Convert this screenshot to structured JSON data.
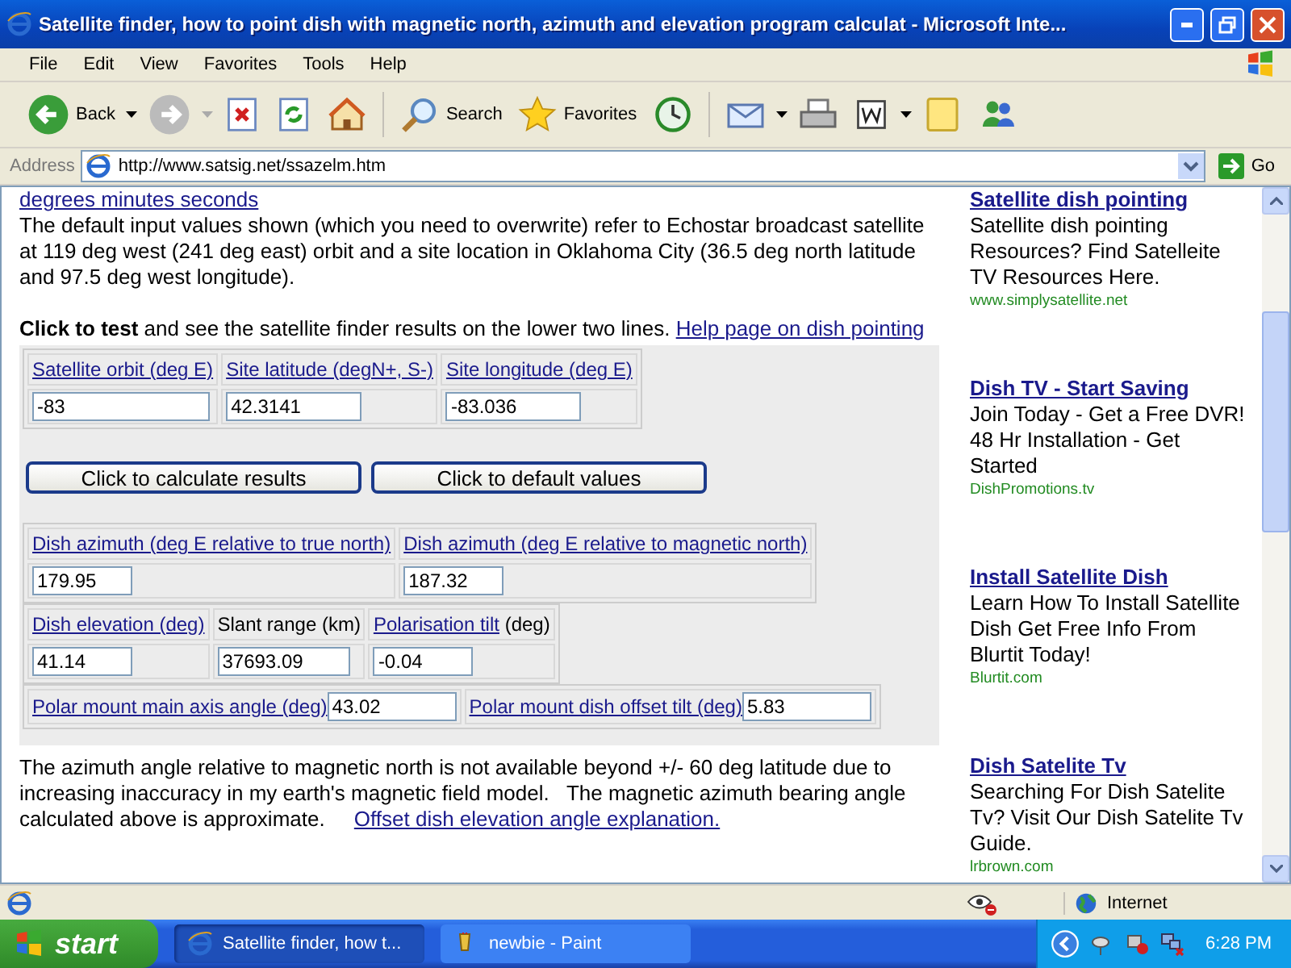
{
  "window": {
    "title": "Satellite finder, how to point dish with magnetic north, azimuth and elevation program calculat - Microsoft Inte..."
  },
  "menu": [
    "File",
    "Edit",
    "View",
    "Favorites",
    "Tools",
    "Help"
  ],
  "toolbar": [
    {
      "kind": "back",
      "label": "Back"
    },
    {
      "kind": "forward"
    },
    {
      "kind": "stop"
    },
    {
      "kind": "refresh"
    },
    {
      "kind": "home"
    },
    {
      "kind": "search",
      "label": "Search"
    },
    {
      "kind": "favorites",
      "label": "Favorites"
    },
    {
      "kind": "history"
    },
    {
      "kind": "mail"
    },
    {
      "kind": "print"
    },
    {
      "kind": "edit"
    },
    {
      "kind": "notes"
    },
    {
      "kind": "messenger"
    }
  ],
  "address": {
    "label": "Address",
    "value": "http://www.satsig.net/ssazelm.htm",
    "go": "Go"
  },
  "content": {
    "top_link": "degrees minutes seconds",
    "intro": "The default input values shown (which you need to overwrite) refer to Echostar broadcast satellite at 119 deg west (241 deg east) orbit and a site location in Oklahoma City (36.5 deg north latitude and 97.5 deg west longitude).",
    "test_line": {
      "text": "**Click to test** and see the satellite finder results on the lower two lines.",
      "link": "Help page on dish pointing"
    },
    "inputs": [
      {
        "label": "Satellite orbit (deg E)",
        "value": "-83"
      },
      {
        "label": "Site latitude (degN+, S-)",
        "value": "42.3141"
      },
      {
        "label": "Site longitude (deg E)",
        "value": "-83.036"
      }
    ],
    "buttons": [
      "Click to calculate results",
      "Click to default values"
    ],
    "result_rows": [
      {
        "kind": "stacked",
        "cells": [
          {
            "kind": "link",
            "label": "Dish azimuth (deg E relative to true north)",
            "value": "179.95"
          },
          {
            "kind": "link",
            "label": "Dish azimuth (deg E relative to magnetic north)",
            "value": "187.32"
          }
        ]
      },
      {
        "kind": "stacked",
        "cells": [
          {
            "kind": "link",
            "label": "Dish elevation (deg)",
            "value": "41.14"
          },
          {
            "kind": "plain",
            "label": "Slant range (km)",
            "value": "37693.09"
          },
          {
            "kind": "link",
            "label": "Polarisation tilt",
            "suffix": "(deg)",
            "value": "-0.04"
          }
        ]
      },
      {
        "kind": "inline",
        "cells": [
          {
            "kind": "link",
            "label": "Polar mount main axis angle (deg)",
            "value": "43.02"
          },
          {
            "kind": "link",
            "label": "Polar mount dish offset tilt (deg)",
            "value": "5.83"
          }
        ]
      }
    ],
    "note": {
      "text": "The azimuth angle relative to magnetic north is not available beyond +/- 60 deg latitude due to increasing inaccuracy in my earth's magnetic field model.   The magnetic azimuth bearing angle calculated above is approximate.",
      "link": "Offset dish elevation angle explanation."
    }
  },
  "ads": [
    {
      "title": "Satellite dish pointing",
      "text": "Satellite dish pointing Resources? Find Satelleite TV Resources Here.",
      "url": "www.simplysatellite.net"
    },
    {
      "title": "Dish TV - Start Saving",
      "text": "Join Today - Get a Free DVR! 48 Hr Installation - Get Started",
      "url": "DishPromotions.tv"
    },
    {
      "title": "Install Satellite Dish",
      "text": "Learn How To Install Satellite Dish Get Free Info From Blurtit Today!",
      "url": "Blurtit.com"
    },
    {
      "title": "Dish Satelite Tv",
      "text": "Searching For Dish Satelite Tv? Visit Our Dish Satelite Tv Guide.",
      "url": "lrbrown.com"
    }
  ],
  "status": {
    "zone": "Internet"
  },
  "taskbar": {
    "start": "start",
    "tasks": [
      {
        "label": "Satellite finder, how t...",
        "selected": true
      },
      {
        "label": "newbie - Paint",
        "selected": false
      }
    ],
    "clock": "6:28 PM"
  }
}
